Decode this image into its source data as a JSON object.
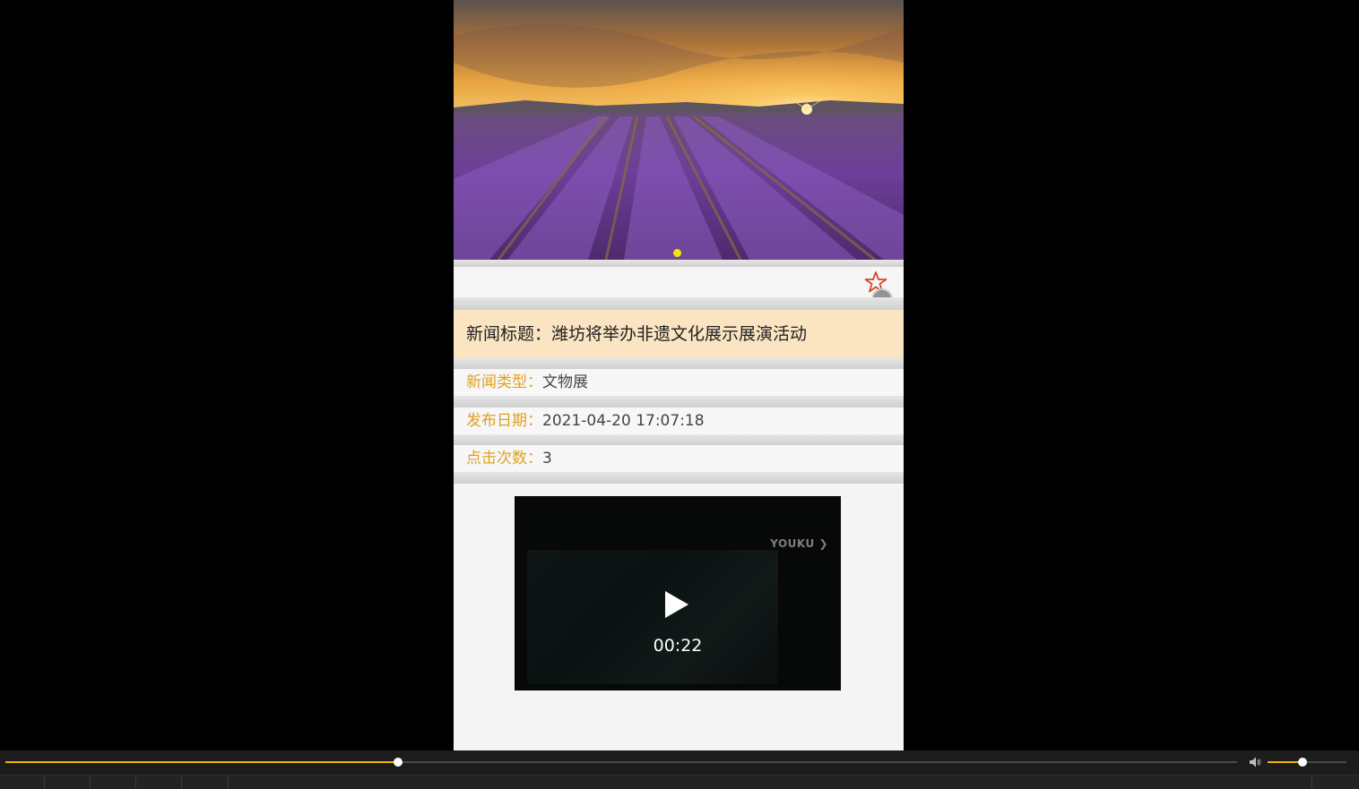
{
  "news": {
    "title_label": "新闻标题：",
    "title": "潍坊将举办非遗文化展示展演活动",
    "type_label": "新闻类型：",
    "type": "文物展",
    "date_label": "发布日期：",
    "date": "2021-04-20 17:07:18",
    "clicks_label": "点击次数：",
    "clicks": "3"
  },
  "banner": {
    "slide_count": 1,
    "active_index": 0
  },
  "favorite": {
    "icon": "star-outline-icon",
    "color": "#d9472a"
  },
  "video": {
    "brand": "YOUKU",
    "duration": "00:22",
    "play_icon": "play-icon"
  },
  "player": {
    "progress": 0.319,
    "volume": 0.44
  },
  "colors": {
    "label": "#e0a020",
    "title_bg": "#fbe4c2",
    "accent": "#f0b400",
    "dot": "#f5e400"
  }
}
